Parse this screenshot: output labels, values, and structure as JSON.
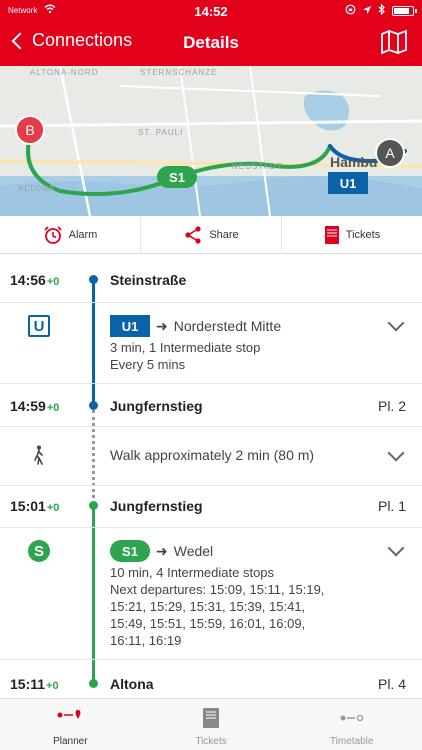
{
  "status_bar": {
    "carrier": "Network",
    "time": "14:52",
    "battery_level": 0.9
  },
  "nav": {
    "back_label": "Connections",
    "title": "Details"
  },
  "map": {
    "labels": [
      "ALTONA-NORD",
      "STERNSCHANZE",
      "ST. PAULI",
      "NEUSTADT",
      "ALTONA"
    ],
    "city_label": "Hambu",
    "marker_start": "A",
    "marker_end": "B",
    "badge_s": "S1",
    "badge_u": "U1",
    "colors": {
      "s_line": "#2ea44f",
      "u_line": "#0a62a8",
      "marker_b": "#e53b46",
      "marker_a": "#555555"
    }
  },
  "actions": {
    "alarm": "Alarm",
    "share": "Share",
    "tickets": "Tickets"
  },
  "journey": {
    "stops": [
      {
        "time": "14:56",
        "delay": "+0",
        "name": "Steinstraße",
        "platform": ""
      },
      {
        "time": "14:59",
        "delay": "+0",
        "name": "Jungfernstieg",
        "platform": "Pl. 2"
      },
      {
        "time": "15:01",
        "delay": "+0",
        "name": "Jungfernstieg",
        "platform": "Pl. 1"
      },
      {
        "time": "15:11",
        "delay": "+0",
        "name": "Altona",
        "platform": "Pl. 4"
      }
    ],
    "segments": {
      "u1": {
        "icon": "U",
        "line": "U1",
        "direction": "Norderstedt Mitte",
        "info1": "3 min, 1 Intermediate stop",
        "info2": "Every 5 mins"
      },
      "walk": {
        "text": "Walk approximately 2 min (80 m)"
      },
      "s1": {
        "icon": "S",
        "line": "S1",
        "direction": "Wedel",
        "info1": "10 min, 4 Intermediate stops",
        "info2": "Next departures: 15:09, 15:11, 15:19,",
        "info3": "15:21, 15:29, 15:31, 15:39, 15:41,",
        "info4": "15:49, 15:51, 15:59, 16:01, 16:09,",
        "info5": "16:11, 16:19"
      }
    },
    "arrow": "➜"
  },
  "tabbar": {
    "planner": "Planner",
    "tickets": "Tickets",
    "timetable": "Timetable"
  }
}
